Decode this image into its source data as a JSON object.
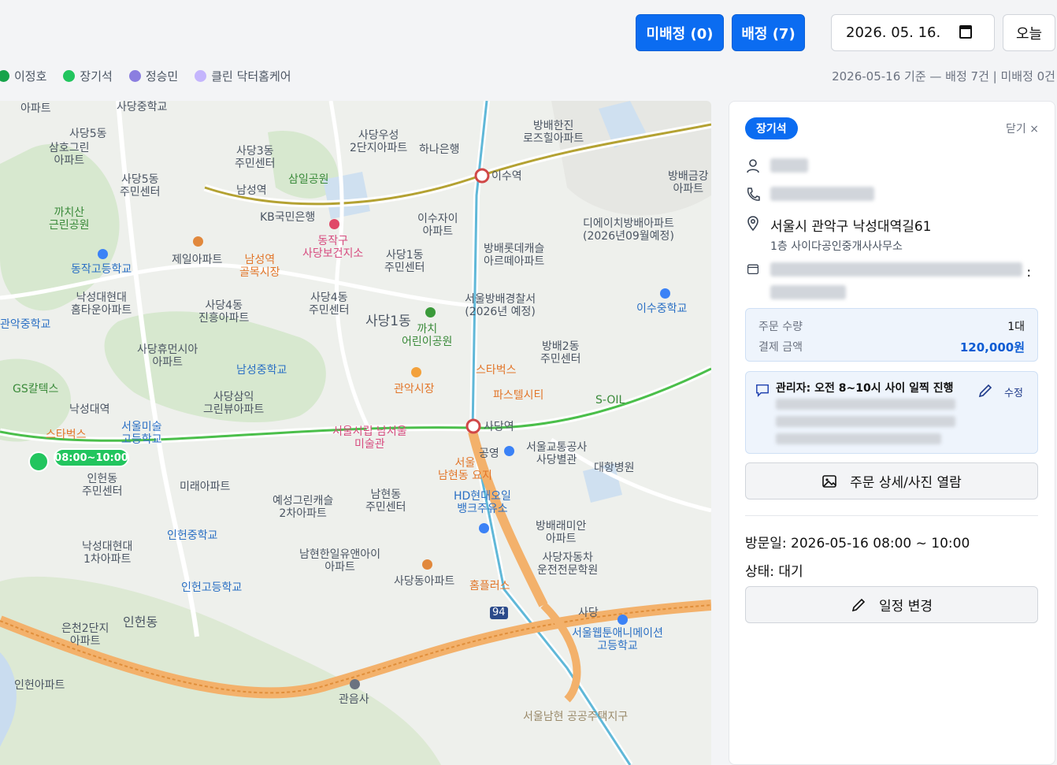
{
  "header": {
    "unassigned_label": "미배정 (0)",
    "assigned_label": "배정 (7)",
    "date_value": "2026. 05. 16.",
    "today_label": "오늘"
  },
  "legend": [
    {
      "name": "이정호",
      "color": "#16a34a"
    },
    {
      "name": "장기석",
      "color": "#22c55e"
    },
    {
      "name": "정승민",
      "color": "#8b7ee0"
    },
    {
      "name": "클린 닥터홈케어",
      "color": "#c4b5fd"
    }
  ],
  "summary": "2026-05-16 기준 — 배정 7건 | 미배정 0건",
  "map": {
    "marker_time": "08:00~10:00",
    "labels": {
      "l1": "아파트",
      "l2": "사당5동",
      "l3": "삼호그린\n아파트",
      "l4": "사당5동\n주민센터",
      "l5": "사당3동\n주민센터",
      "l6": "삼일공원",
      "l7": "남성역",
      "l8": "사당우성\n2단지아파트",
      "l9": "하나은행",
      "l10": "방배한진\n로즈힐아파트",
      "l11": "이수역",
      "l12": "방배금강\n아파트",
      "l13": "까치산\n근린공원",
      "l14": "KB국민은행",
      "l15": "동작구\n사당보건지소",
      "l16": "이수자이\n아파트",
      "l17": "디에이치방배아파트\n(2026년09월예정)",
      "l18": "제일아파트",
      "l19": "남성역\n골목시장",
      "l20": "사당1동\n주민센터",
      "l21": "방배롯데캐슬\n아르떼아파트",
      "l22": "동작고등학교",
      "l23": "낙성대현대\n홈타운아파트",
      "l24": "사당4동\n진흥아파트",
      "l25": "사당4동\n주민센터",
      "l26": "사당1동",
      "l27": "서울방배경찰서\n(2026년 예정)",
      "l28": "이수중학교",
      "l29": "까치\n어린이공원",
      "l30": "방배2동\n주민센터",
      "l31": "사당휴먼시아\n아파트",
      "l32": "남성중학교",
      "l33": "스타벅스",
      "l34": "관악시장",
      "l35": "파스텔시티",
      "l36": "GS칼텍스",
      "l37": "낙성대역",
      "l38": "사당삼익\n그린뷰아파트",
      "l39": "S-OIL",
      "l40": "스타벅스",
      "l41": "서울미술\n고등학교",
      "l42": "서울시립 남서울\n미술관",
      "l43": "사당역",
      "l44": "공영",
      "l45": "서울교통공사\n사당별관",
      "l46": "대항병원",
      "l47": "인헌동\n주민센터",
      "l48": "미래아파트",
      "l49": "예성그린캐슬\n2차아파트",
      "l50": "남현동\n주민센터",
      "l51": "서울\n남현동 요지",
      "l52": "HD현대오일\n뱅크주유소",
      "l53": "인헌중학교",
      "l54": "낙성대현대\n1차아파트",
      "l55": "남현한일유앤아이\n아파트",
      "l56": "방배래미안\n아파트",
      "l57": "사당자동차\n운전전문학원",
      "l58": "인헌고등학교",
      "l59": "사당동아파트",
      "l60": "홈플러스",
      "l61": "은천2단지\n아파트",
      "l62": "인헌동",
      "l63": "서울웹툰애니메이션\n고등학교",
      "l64": "관음사",
      "l65": "인헌아파트",
      "l66": "서울남현 공공주택지구",
      "l67": "관악중학교",
      "l68": "사당중학교",
      "l69": "사당",
      "l70": "94"
    }
  },
  "panel": {
    "worker_badge": "장기석",
    "close_label": "닫기 ×",
    "address": "서울시 관악구 낙성대역길61",
    "address_detail": "1층 사이다공인중개사사무소",
    "schedule_suffix": ":",
    "order": {
      "qty_label": "주문 수량",
      "qty_value": "1대",
      "amount_label": "결제 금액",
      "amount_value": "120,000원"
    },
    "memo": {
      "text": "관리자: 오전 8~10시 사이 일찍 진행",
      "edit_label": "수정"
    },
    "detail_button": "주문 상세/사진 열람",
    "visit_date": "방문일: 2026-05-16 08:00 ~ 10:00",
    "status": "상태: 대기",
    "change_button": "일정 변경"
  }
}
